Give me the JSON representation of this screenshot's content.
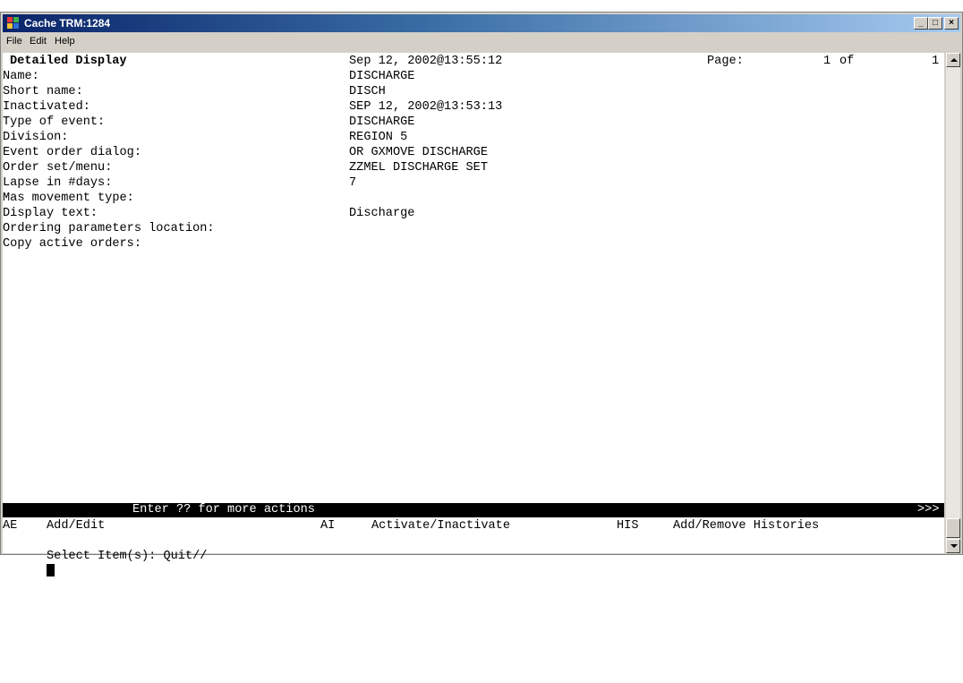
{
  "window": {
    "title": "Cache TRM:1284",
    "minimize": "_",
    "maximize": "□",
    "close": "×"
  },
  "menu": [
    "File",
    "Edit",
    "Help"
  ],
  "screen": {
    "header": {
      "title": "Detailed Display",
      "datetime": "Sep 12, 2002@13:55:12",
      "page_label": "Page:",
      "page_current": "1",
      "page_of": "of",
      "page_total": "1"
    },
    "fields": [
      {
        "label": "Name:",
        "value": "DISCHARGE"
      },
      {
        "label": "Short name:",
        "value": "DISCH"
      },
      {
        "label": "Inactivated:",
        "value": "SEP 12, 2002@13:53:13"
      },
      {
        "label": "Type of event:",
        "value": "DISCHARGE"
      },
      {
        "label": "Division:",
        "value": "REGION 5"
      },
      {
        "label": "Event order dialog:",
        "value": "OR GXMOVE DISCHARGE"
      },
      {
        "label": "Order set/menu:",
        "value": "ZZMEL DISCHARGE SET"
      },
      {
        "label": "Lapse in #days:",
        "value": "7"
      },
      {
        "label": "Mas movement type:",
        "value": ""
      },
      {
        "label": "Display text:",
        "value": "Discharge"
      },
      {
        "label": "Ordering parameters location:",
        "value": ""
      },
      {
        "label": "Copy active orders:",
        "value": ""
      }
    ],
    "more_actions": "Enter ?? for more actions",
    "more_indicator": ">>>",
    "actions": [
      {
        "code": "AE",
        "label": "Add/Edit"
      },
      {
        "code": "AI",
        "label": "Activate/Inactivate"
      },
      {
        "code": "HIS",
        "label": "Add/Remove Histories"
      }
    ],
    "prompt": "Select Item(s): Quit//"
  }
}
